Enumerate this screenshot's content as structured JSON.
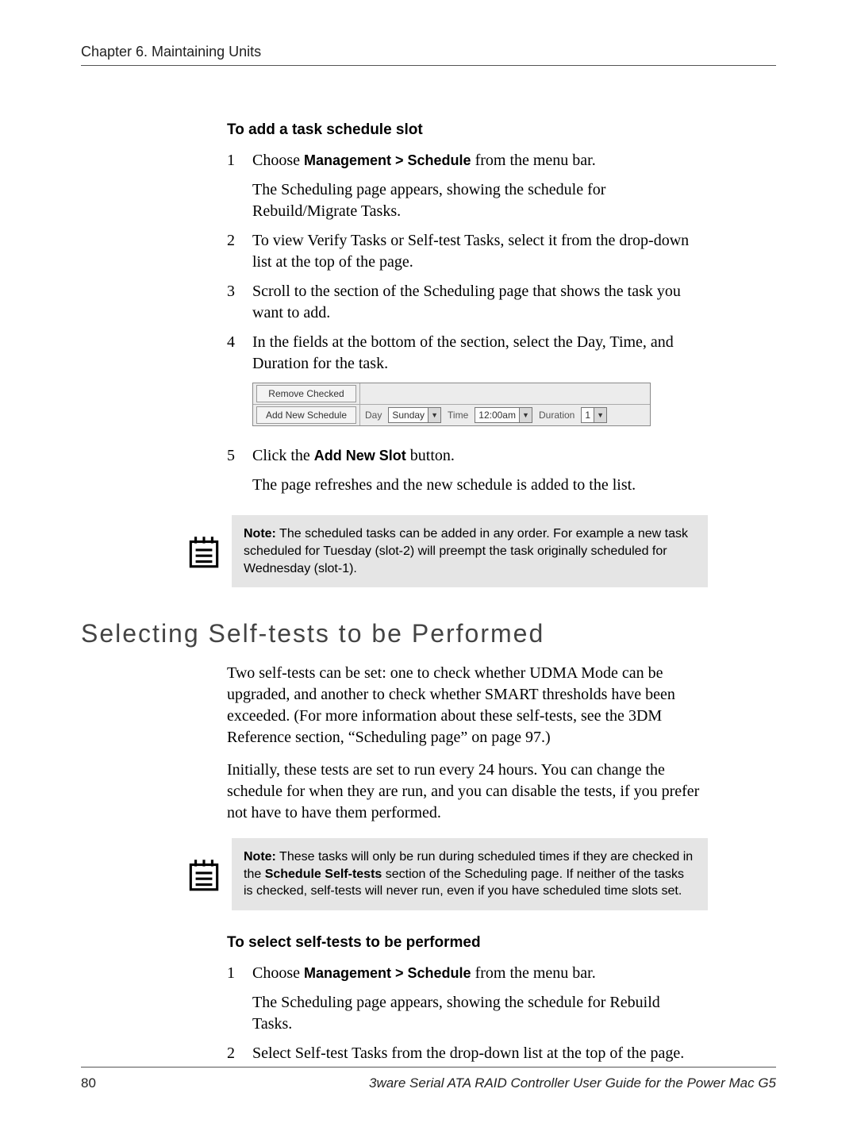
{
  "header": {
    "chapter": "Chapter 6. Maintaining Units"
  },
  "sec1": {
    "title": "To add a task schedule slot",
    "steps": [
      {
        "n": "1",
        "l1a": "Choose ",
        "l1b": "Management > Schedule",
        "l1c": " from the menu bar.",
        "l2": "The Scheduling page appears, showing the schedule for Rebuild/Migrate Tasks."
      },
      {
        "n": "2",
        "l1": "To view Verify Tasks or Self-test Tasks, select it from the drop-down list at the top of the page."
      },
      {
        "n": "3",
        "l1": "Scroll to the section of the Scheduling page that shows the task you want to add."
      },
      {
        "n": "4",
        "l1": "In the fields at the bottom of the section, select the Day, Time, and Duration for the task."
      },
      {
        "n": "5",
        "l1a": "Click the ",
        "l1b": "Add New Slot",
        "l1c": " button.",
        "l2": "The page refreshes and the new schedule is added to the list."
      }
    ]
  },
  "ui": {
    "remove": "Remove Checked",
    "add": "Add New Schedule",
    "day_label": "Day",
    "day_value": "Sunday",
    "time_label": "Time",
    "time_value": "12:00am",
    "dur_label": "Duration",
    "dur_value": "1"
  },
  "note1": {
    "label": "Note:",
    "text": " The scheduled tasks can be added in any order. For example a new task scheduled for Tuesday (slot-2) will preempt the task originally scheduled for Wednesday (slot-1)."
  },
  "h2": "Selecting Self-tests to be Performed",
  "p1": "Two self-tests can be set: one to check whether UDMA Mode can be upgraded, and another to check whether SMART thresholds have been exceeded. (For more information about these self-tests, see the 3DM Reference section, “Scheduling page” on page 97.)",
  "p2": "Initially, these tests are set to run every 24 hours. You can change the schedule for when they are run, and you can disable the tests, if you prefer not have to have them performed.",
  "note2": {
    "label": "Note:",
    "t1": " These tasks will only be run during scheduled times if they are checked in the ",
    "t2": "Schedule Self-tests",
    "t3": " section of the Scheduling page. If neither of the tasks is checked, self-tests will never run, even if you have scheduled time slots set."
  },
  "sec2": {
    "title": "To select self-tests to be performed",
    "steps": [
      {
        "n": "1",
        "l1a": "Choose ",
        "l1b": "Management > Schedule",
        "l1c": " from the menu bar.",
        "l2": "The Scheduling page appears, showing the schedule for Rebuild Tasks."
      },
      {
        "n": "2",
        "l1": "Select Self-test Tasks from the drop-down list at the top of the page."
      }
    ]
  },
  "footer": {
    "page": "80",
    "title": "3ware Serial ATA RAID Controller User Guide for the Power Mac G5"
  }
}
